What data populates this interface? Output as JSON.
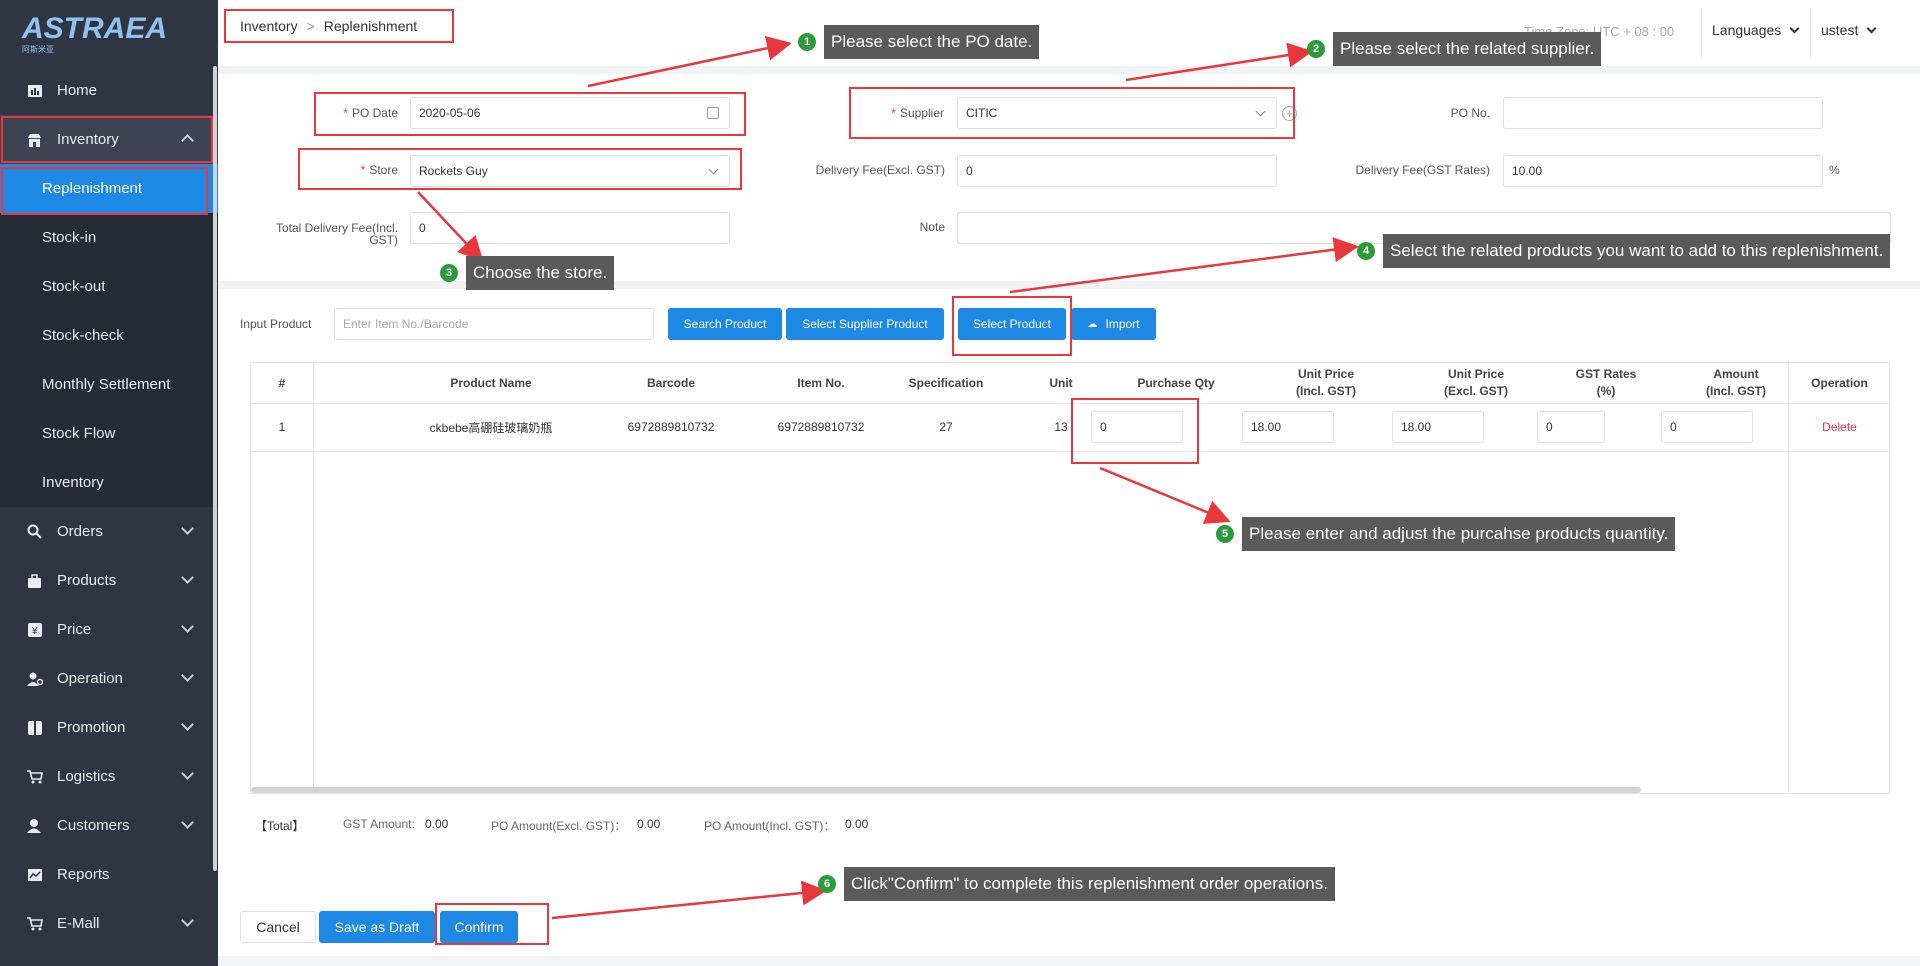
{
  "logo": {
    "text": "ASTRAEA",
    "subtext": "阿斯米亚"
  },
  "sidebar": {
    "items": [
      {
        "label": "Home",
        "icon": "chart-icon"
      },
      {
        "label": "Inventory",
        "icon": "store-icon"
      },
      {
        "label": "Orders",
        "icon": "search-icon"
      },
      {
        "label": "Products",
        "icon": "bag-icon"
      },
      {
        "label": "Price",
        "icon": "price-tag-icon"
      },
      {
        "label": "Operation",
        "icon": "user-gear-icon"
      },
      {
        "label": "Promotion",
        "icon": "gift-icon"
      },
      {
        "label": "Logistics",
        "icon": "cart-icon"
      },
      {
        "label": "Customers",
        "icon": "users-icon"
      },
      {
        "label": "Reports",
        "icon": "chart-icon"
      },
      {
        "label": "E-Mall",
        "icon": "cart-icon"
      }
    ],
    "inventory_sub": [
      "Replenishment",
      "Stock-in",
      "Stock-out",
      "Stock-check",
      "Monthly Settlement",
      "Stock Flow",
      "Inventory"
    ]
  },
  "header": {
    "breadcrumb": [
      "Inventory",
      "Replenishment"
    ],
    "timezone": "Time Zone: UTC + 08 : 00",
    "languages": "Languages",
    "user": "ustest"
  },
  "form": {
    "po_date_label": "PO Date",
    "po_date": "2020-05-06",
    "supplier_label": "Supplier",
    "supplier": "CITIC",
    "po_no_label": "PO No.",
    "po_no": "",
    "store_label": "Store",
    "store": "Rockets Guy",
    "delivery_fee_label": "Delivery Fee(Excl. GST)",
    "delivery_fee": "0",
    "delivery_gst_label": "Delivery Fee(GST Rates)",
    "delivery_gst": "10.00",
    "percent": "%",
    "total_delivery_label": "Total Delivery Fee(Incl. GST)",
    "total_delivery": "0",
    "note_label": "Note",
    "note": ""
  },
  "product_bar": {
    "input_label": "Input Product",
    "input_placeholder": "Enter Item No./Barcode",
    "search_btn": "Search Product",
    "supplier_btn": "Select Supplier Product",
    "select_btn": "Select Product",
    "import_btn": "Import"
  },
  "table": {
    "headers": [
      "#",
      "Product Name",
      "Barcode",
      "Item No.",
      "Specification",
      "Unit",
      "Purchase Qty",
      "Unit Price\n(Incl. GST)",
      "Unit Price\n(Excl. GST)",
      "GST Rates\n(%)",
      "Amount\n(Incl. GST)",
      "Operation"
    ],
    "rows": [
      {
        "no": "1",
        "name": "ckbebe高硼硅玻璃奶瓶",
        "barcode": "6972889810732",
        "item_no": "6972889810732",
        "spec": "27",
        "unit": "13",
        "qty": "0",
        "price_incl": "18.00",
        "price_excl": "18.00",
        "gst": "0",
        "amount": "0",
        "op": "Delete"
      }
    ]
  },
  "totals": {
    "label": "【Total】",
    "gst_label": "GST Amount:",
    "gst": "0.00",
    "po_excl_label": "PO Amount(Excl. GST)：",
    "po_excl": "0.00",
    "po_incl_label": "PO Amount(Incl. GST)：",
    "po_incl": "0.00"
  },
  "footer": {
    "cancel": "Cancel",
    "draft": "Save as Draft",
    "confirm": "Confirm"
  },
  "tips": [
    {
      "n": "1",
      "text": "Please select the PO date."
    },
    {
      "n": "2",
      "text": "Please select the related supplier."
    },
    {
      "n": "3",
      "text": "Choose the store."
    },
    {
      "n": "4",
      "text": "Select the related products you want to add to this replenishment."
    },
    {
      "n": "5",
      "text": "Please enter and adjust the purcahse products quantity."
    },
    {
      "n": "6",
      "text": "Click\"Confirm\" to complete this replenishment order operations."
    }
  ],
  "colors": {
    "primary": "#1e88e5",
    "annotation": "#e8383d",
    "sidebar": "#2f3542",
    "badge": "#2e9b3a",
    "danger": "#e8383d"
  }
}
